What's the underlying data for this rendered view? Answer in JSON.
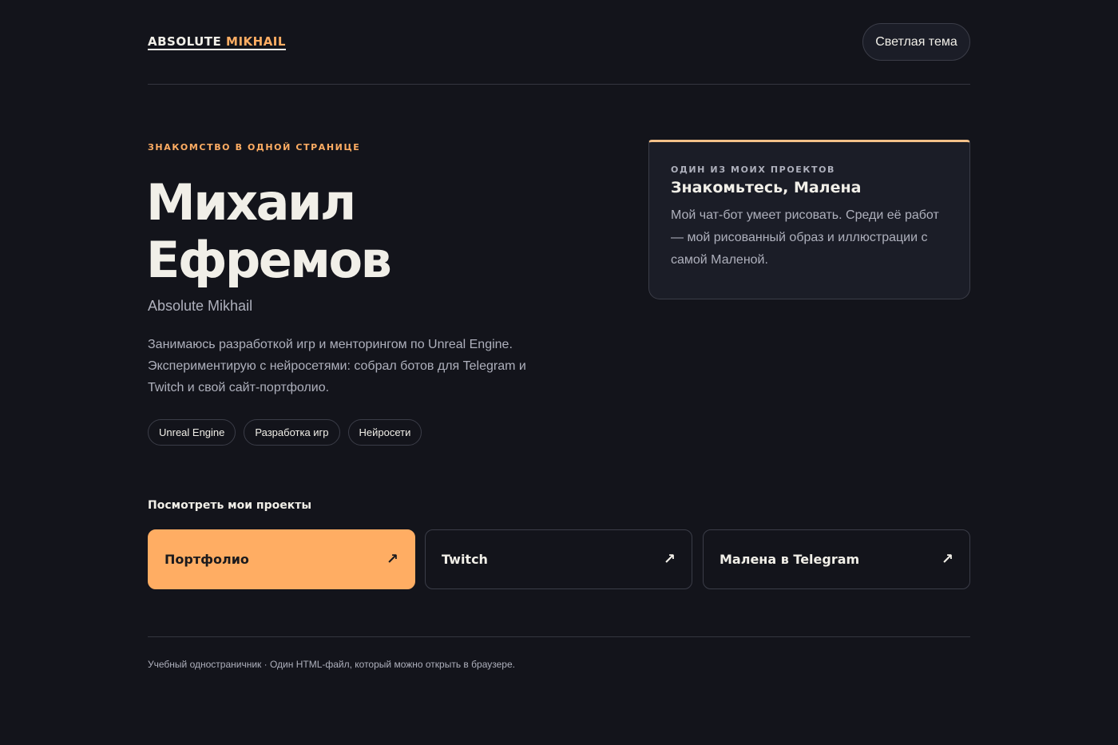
{
  "header": {
    "logo_part1": "ABSOLUTE",
    "logo_part2": "MIKHAIL",
    "theme_button": "Светлая тема"
  },
  "hero": {
    "eyebrow": "ЗНАКОМСТВО В ОДНОЙ СТРАНИЦЕ",
    "name_line1": "Михаил",
    "name_line2": "Ефремов",
    "alias": "Absolute Mikhail",
    "bio": "Занимаюсь разработкой игр и менторингом по Unreal Engine. Экспериментирую с нейросетями: собрал ботов для Telegram и Twitch и свой сайт-портфолио.",
    "tags": [
      "Unreal Engine",
      "Разработка игр",
      "Нейросети"
    ]
  },
  "card": {
    "eyebrow": "ОДИН ИЗ МОИХ ПРОЕКТОВ",
    "title": "Знакомьтесь, Малена",
    "text": "Мой чат-бот умеет рисовать. Среди её работ — мой рисованный образ и иллюстрации с самой Маленой."
  },
  "projects": {
    "label": "Посмотреть мои проекты",
    "items": [
      {
        "label": "Портфолио",
        "arrow": "↗",
        "icon": "arrow-up-right-icon"
      },
      {
        "label": "Twitch",
        "arrow": "↗",
        "icon": "arrow-up-right-icon"
      },
      {
        "label": "Малена в Telegram",
        "arrow": "↗",
        "icon": "arrow-up-right-icon"
      }
    ]
  },
  "footer": {
    "text": "Учебный одностраничник · Один HTML-файл, который можно открыть в браузере."
  },
  "colors": {
    "background": "#13141b",
    "accent": "#ffad63",
    "card_top_border": "#f3c089",
    "text": "#f1efe8",
    "muted": "#aeb0bc"
  }
}
